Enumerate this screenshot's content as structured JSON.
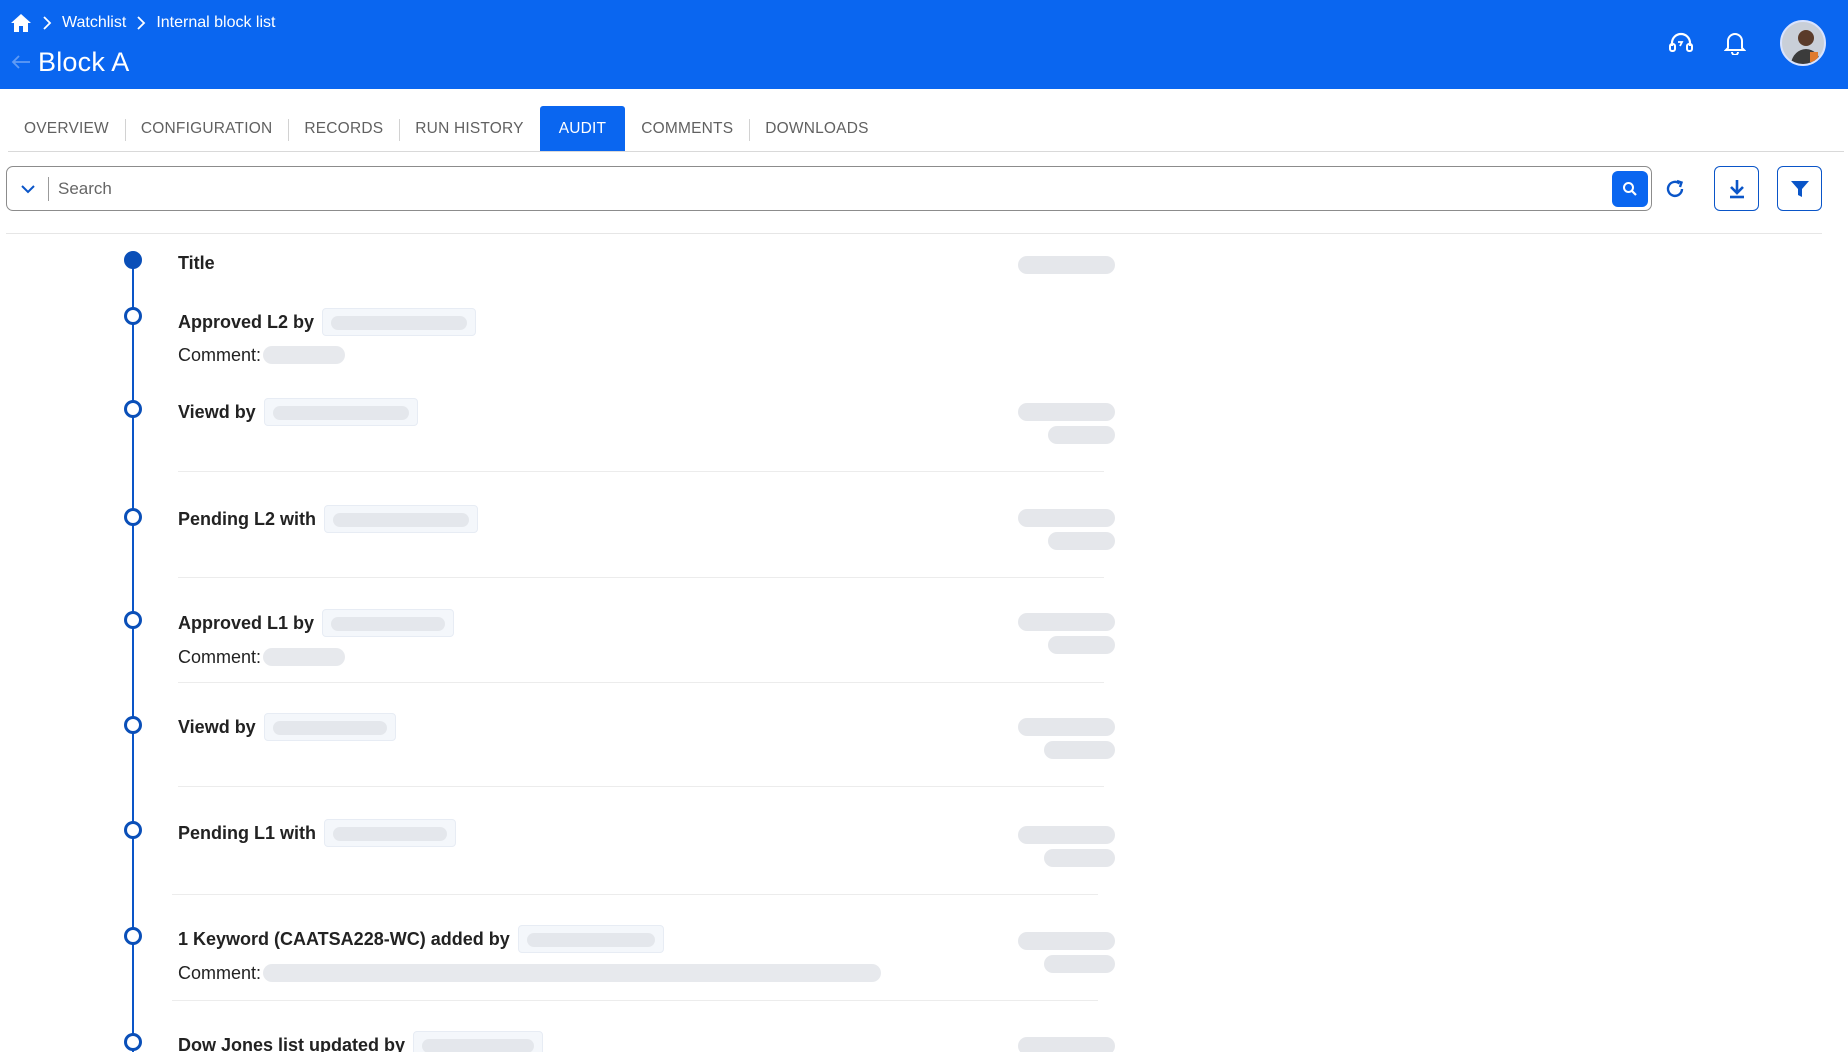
{
  "header": {
    "breadcrumbs": [
      "Watchlist",
      "Internal block list"
    ],
    "title": "Block A",
    "icons": [
      "home-icon",
      "support-icon",
      "bell-icon",
      "avatar"
    ]
  },
  "tabs": [
    {
      "label": "OVERVIEW",
      "active": false
    },
    {
      "label": "CONFIGURATION",
      "active": false
    },
    {
      "label": "RECORDS",
      "active": false
    },
    {
      "label": "RUN HISTORY",
      "active": false
    },
    {
      "label": "AUDIT",
      "active": true
    },
    {
      "label": "COMMENTS",
      "active": false
    },
    {
      "label": "DOWNLOADS",
      "active": false
    }
  ],
  "search": {
    "placeholder": "Search",
    "value": ""
  },
  "colors": {
    "header_bg": "#0a66f0",
    "timeline": "#0a4fb8",
    "skeleton": "#e5e7eb"
  },
  "audit": {
    "comment_label": "Comment:",
    "events": [
      {
        "title": "Title"
      },
      {
        "title": "Approved L2 by",
        "has_comment": true
      },
      {
        "title": "Viewd by"
      },
      {
        "title": "Pending L2 with"
      },
      {
        "title": "Approved L1 by",
        "has_comment": true
      },
      {
        "title": "Viewd by"
      },
      {
        "title": "Pending L1 with"
      },
      {
        "title": "1 Keyword (CAATSA228-WC) added by",
        "has_comment": true
      },
      {
        "title": "Dow Jones list updated by"
      }
    ]
  }
}
